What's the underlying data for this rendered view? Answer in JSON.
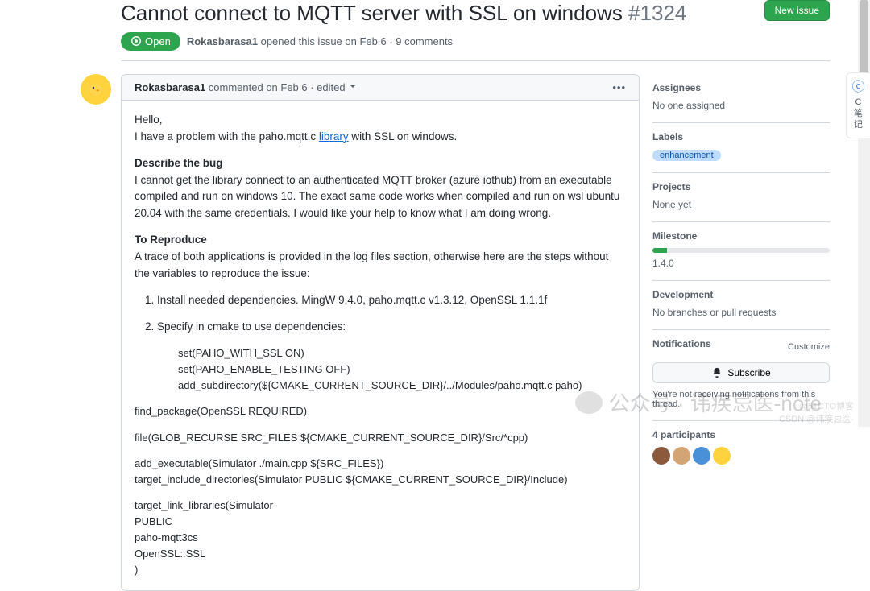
{
  "header": {
    "title": "Cannot connect to MQTT server with SSL on windows",
    "issue_number": "#1324",
    "new_issue_label": "New issue",
    "state": "Open",
    "meta_author": "Rokasbarasa1",
    "meta_text": " opened this issue on Feb 6 · 9 comments"
  },
  "comment": {
    "author": "Rokasbarasa1",
    "timestamp": " commented on Feb 6 · edited ",
    "body": {
      "greeting": "Hello,",
      "intro_pre": "I have a problem with the paho.mqtt.c ",
      "intro_link": "library",
      "intro_post": " with SSL on windows.",
      "describe_h": "Describe the bug",
      "describe_text": "I cannot get the library connect to an authenticated MQTT broker (azure iothub) from an executable compiled and run on windows 10. The exact same code works when compiled and run on wsl ubuntu 20.04 with the same credentials. I would like your help to know what I am doing wrong.",
      "reproduce_h": "To Reproduce",
      "reproduce_text": "A trace of both applications is provided in the log files section, otherwise here are the steps without the variables to reproduce the issue:",
      "step1": "Install needed dependencies. MingW 9.4.0, paho.mqtt.c v1.3.12, OpenSSL 1.1.1f",
      "step2": "Specify in cmake to use dependencies:",
      "code1": "set(PAHO_WITH_SSL ON)\nset(PAHO_ENABLE_TESTING OFF)\nadd_subdirectory(${CMAKE_CURRENT_SOURCE_DIR}/../Modules/paho.mqtt.c paho)",
      "code2": "find_package(OpenSSL REQUIRED)",
      "code3": "file(GLOB_RECURSE SRC_FILES ${CMAKE_CURRENT_SOURCE_DIR}/Src/*cpp)",
      "code4": "add_executable(Simulator ./main.cpp ${SRC_FILES})\ntarget_include_directories(Simulator PUBLIC ${CMAKE_CURRENT_SOURCE_DIR}/Include)",
      "code5": "target_link_libraries(Simulator\nPUBLIC\npaho-mqtt3cs\nOpenSSL::SSL\n)"
    }
  },
  "sidebar": {
    "assignees_h": "Assignees",
    "assignees_v": "No one assigned",
    "labels_h": "Labels",
    "label_pill": "enhancement",
    "projects_h": "Projects",
    "projects_v": "None yet",
    "milestone_h": "Milestone",
    "milestone_v": "1.4.0",
    "dev_h": "Development",
    "dev_v": "No branches or pull requests",
    "notif_h": "Notifications",
    "customize": "Customize",
    "subscribe": "Subscribe",
    "notif_note": "You're not receiving notifications from this thread.",
    "participants_h": "4 participants"
  },
  "float_tab": "C\n笔\n记",
  "watermark": "公众号 · 讳疾忌医-note",
  "corner": "@51CTO博客\nCSDN @讳疾忌医-"
}
